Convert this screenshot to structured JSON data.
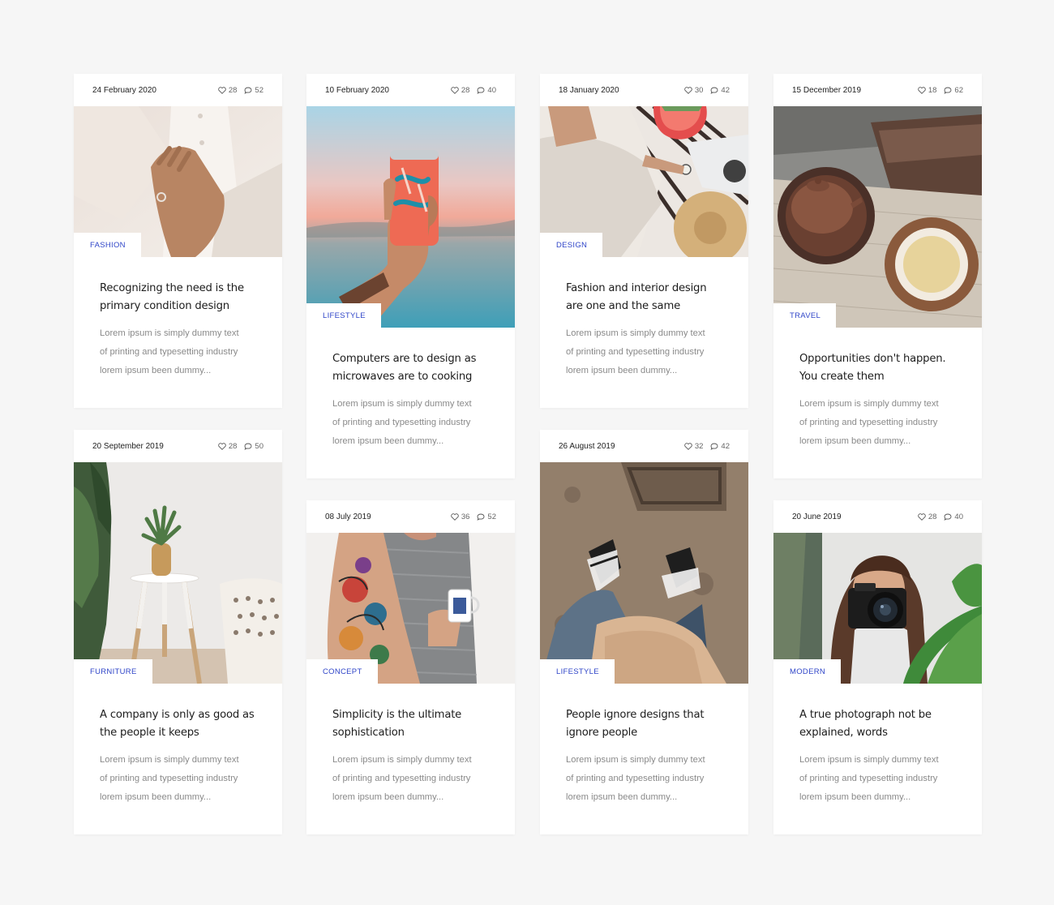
{
  "cards": [
    {
      "date": "24 February 2020",
      "likes": "28",
      "comments": "52",
      "category": "FASHION",
      "title_line1": "Recognizing the need is the",
      "title_line2": "primary condition design",
      "excerpt_line1": "Lorem ipsum is simply dummy text",
      "excerpt_line2": "of printing and typesetting industry",
      "excerpt_line3": "lorem ipsum been dummy..."
    },
    {
      "date": "10 February 2020",
      "likes": "28",
      "comments": "40",
      "category": "LIFESTYLE",
      "title_line1": "Computers are to design as",
      "title_line2": "microwaves are to cooking",
      "excerpt_line1": "Lorem ipsum is simply dummy text",
      "excerpt_line2": "of printing and typesetting industry",
      "excerpt_line3": "lorem ipsum been dummy..."
    },
    {
      "date": "18 January 2020",
      "likes": "30",
      "comments": "42",
      "category": "DESIGN",
      "title_line1": "Fashion and interior design",
      "title_line2": "are one and the same",
      "excerpt_line1": "Lorem ipsum is simply dummy text",
      "excerpt_line2": "of printing and typesetting industry",
      "excerpt_line3": "lorem ipsum been dummy..."
    },
    {
      "date": "15 December 2019",
      "likes": "18",
      "comments": "62",
      "category": "TRAVEL",
      "title_line1": "Opportunities don't happen.",
      "title_line2": "You create them",
      "excerpt_line1": "Lorem ipsum is simply dummy text",
      "excerpt_line2": "of printing and typesetting industry",
      "excerpt_line3": "lorem ipsum been dummy..."
    },
    {
      "date": "20 September 2019",
      "likes": "28",
      "comments": "50",
      "category": "FURNITURE",
      "title_line1": "A company is only as good as",
      "title_line2": "the people it keeps",
      "excerpt_line1": "Lorem ipsum is simply dummy text",
      "excerpt_line2": "of printing and typesetting industry",
      "excerpt_line3": "lorem ipsum been dummy..."
    },
    {
      "date": "08 July 2019",
      "likes": "36",
      "comments": "52",
      "category": "CONCEPT",
      "title_line1": "Simplicity is the ultimate",
      "title_line2": "sophistication",
      "excerpt_line1": "Lorem ipsum is simply dummy text",
      "excerpt_line2": "of printing and typesetting industry",
      "excerpt_line3": "lorem ipsum been dummy..."
    },
    {
      "date": "26 August 2019",
      "likes": "32",
      "comments": "42",
      "category": "LIFESTYLE",
      "title_line1": "People ignore designs that",
      "title_line2": "ignore people",
      "excerpt_line1": "Lorem ipsum is simply dummy text",
      "excerpt_line2": "of printing and typesetting industry",
      "excerpt_line3": "lorem ipsum been dummy..."
    },
    {
      "date": "20 June 2019",
      "likes": "28",
      "comments": "40",
      "category": "MODERN",
      "title_line1": "A true photograph not be",
      "title_line2": "explained, words",
      "excerpt_line1": "Lorem ipsum is simply dummy text",
      "excerpt_line2": "of printing and typesetting industry",
      "excerpt_line3": "lorem ipsum been dummy..."
    }
  ],
  "colors": {
    "background": "#f6f6f6",
    "card": "#ffffff",
    "category": "#2f45c8",
    "title": "#1d1d1d",
    "excerpt": "#8a8a8a"
  },
  "icons": {
    "likes": "heart-icon",
    "comments": "comment-bubble-icon"
  }
}
